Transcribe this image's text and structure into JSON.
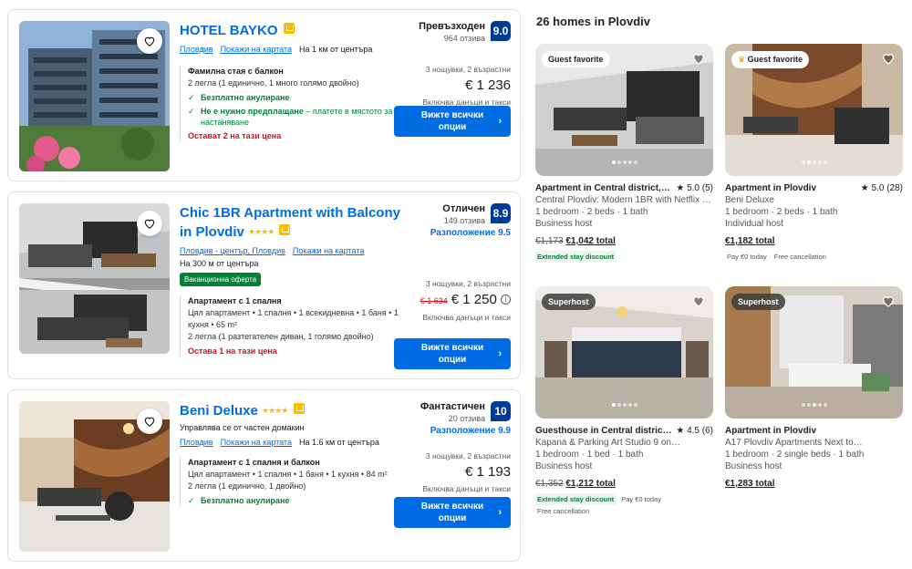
{
  "listings": [
    {
      "name": "HOTEL BAYKO",
      "stars": "",
      "loc_link": "Пловдив",
      "map_link": "Покажи на картата",
      "distance": "На 1 км от центъра",
      "rating_word": "Превъзходен",
      "reviews": "964 отзива",
      "score": "9.0",
      "room_title": "Фамилна стая с балкон",
      "room_desc": "2 легла (1 единично, 1 много голямо двойно)",
      "perk1": "Безплатно анулиране",
      "perk2": "Не е нужно предплащане",
      "perk2_sub": " – платете в мястото за настаняване",
      "warn": "Остават 2 на тази цена",
      "nights": "3 нощувки, 2 възрастни",
      "price": "€ 1 236",
      "taxes": "Включва данъци и такси",
      "cta": "Вижте всички опции"
    },
    {
      "name": "Chic 1BR Apartment with Balcony in Plovdiv",
      "stars": "★★★★",
      "loc_link": "Пловдив - център, Пловдив",
      "map_link": "Покажи на картата",
      "distance": "На 300 м от центъра",
      "deal": "Ваканционна оферта",
      "rating_word": "Отличен",
      "reviews": "149 отзива",
      "score": "8.9",
      "loc_score": "Разположение 9.5",
      "room_title": "Апартамент с 1 спалня",
      "room_desc": "Цял апартамент • 1 спалня • 1 всекидневна • 1 баня • 1 кухня • 65 m²",
      "room_desc2": "2 легла (1 разтегателен диван, 1 голямо двойно)",
      "warn": "Остава 1 на тази цена",
      "nights": "3 нощувки, 2 възрастни",
      "old_price": "€ 1 634",
      "price": "€ 1 250",
      "taxes": "Включва данъци и такси",
      "cta": "Вижте всички опции"
    },
    {
      "name": "Beni Deluxe",
      "stars": "★★★★",
      "managed": "Управлява се от частен домакин",
      "loc_link": "Пловдив",
      "map_link": "Покажи на картата",
      "distance": "На 1.6 км от центъра",
      "rating_word": "Фантастичен",
      "reviews": "20 отзива",
      "score": "10",
      "loc_score": "Разположение 9.9",
      "room_title": "Апартамент с 1 спалня и балкон",
      "room_desc": "Цял апартамент • 1 спалня • 1 баня • 1 кухня • 84 m²",
      "room_desc2": "2 легла (1 единично, 1 двойно)",
      "perk1": "Безплатно анулиране",
      "nights": "3 нощувки, 2 възрастни",
      "price": "€ 1 193",
      "taxes": "Включва данъци и такси",
      "cta": "Вижте всички опции"
    }
  ],
  "airbnb": {
    "title": "26 homes in Plovdiv",
    "cards": [
      {
        "badge": "Guest favorite",
        "title": "Apartment in Central district, Pl…",
        "rating": "★ 5.0 (5)",
        "line1": "Central Plovdiv: Modern 1BR with Netflix &…",
        "line2": "1 bedroom · 2 beds · 1 bath",
        "line3": "Business host",
        "old": "€1,173",
        "price": "€1,042 total",
        "chips": [
          "Extended stay discount"
        ]
      },
      {
        "badge": "Guest favorite",
        "title": "Apartment in Plovdiv",
        "rating": "★ 5.0 (28)",
        "line1": "Beni Deluxe",
        "line2": "1 bedroom · 2 beds · 1 bath",
        "line3": "Individual host",
        "old": "",
        "price": "€1,182 total",
        "chips": [
          "Pay €0 today",
          "Free cancellation"
        ]
      },
      {
        "badge": "Superhost",
        "title": "Guesthouse in Central district, …",
        "rating": "★ 4.5 (6)",
        "line1": "Kapana & Parking Art Studio 9 on…",
        "line2": "1 bedroom · 1 bed · 1 bath",
        "line3": "Business host",
        "old": "€1,352",
        "price": "€1,212 total",
        "chips": [
          "Extended stay discount",
          "Pay €0 today",
          "Free cancellation"
        ]
      },
      {
        "badge": "Superhost",
        "title": "Apartment in Plovdiv",
        "rating": "",
        "line1": "A17 Plovdiv Apartments Next to…",
        "line2": "1 bedroom · 2 single beds · 1 bath",
        "line3": "Business host",
        "old": "",
        "price": "€1,283 total",
        "chips": []
      }
    ]
  },
  "colors": {
    "booking_blue": "#006ce4",
    "score_navy": "#003b95",
    "green": "#008234",
    "red": "#d4111e",
    "star": "#febb02"
  },
  "icons": [
    "heart-icon",
    "check-icon",
    "chevron-right-icon",
    "info-icon",
    "laurel-icon"
  ]
}
